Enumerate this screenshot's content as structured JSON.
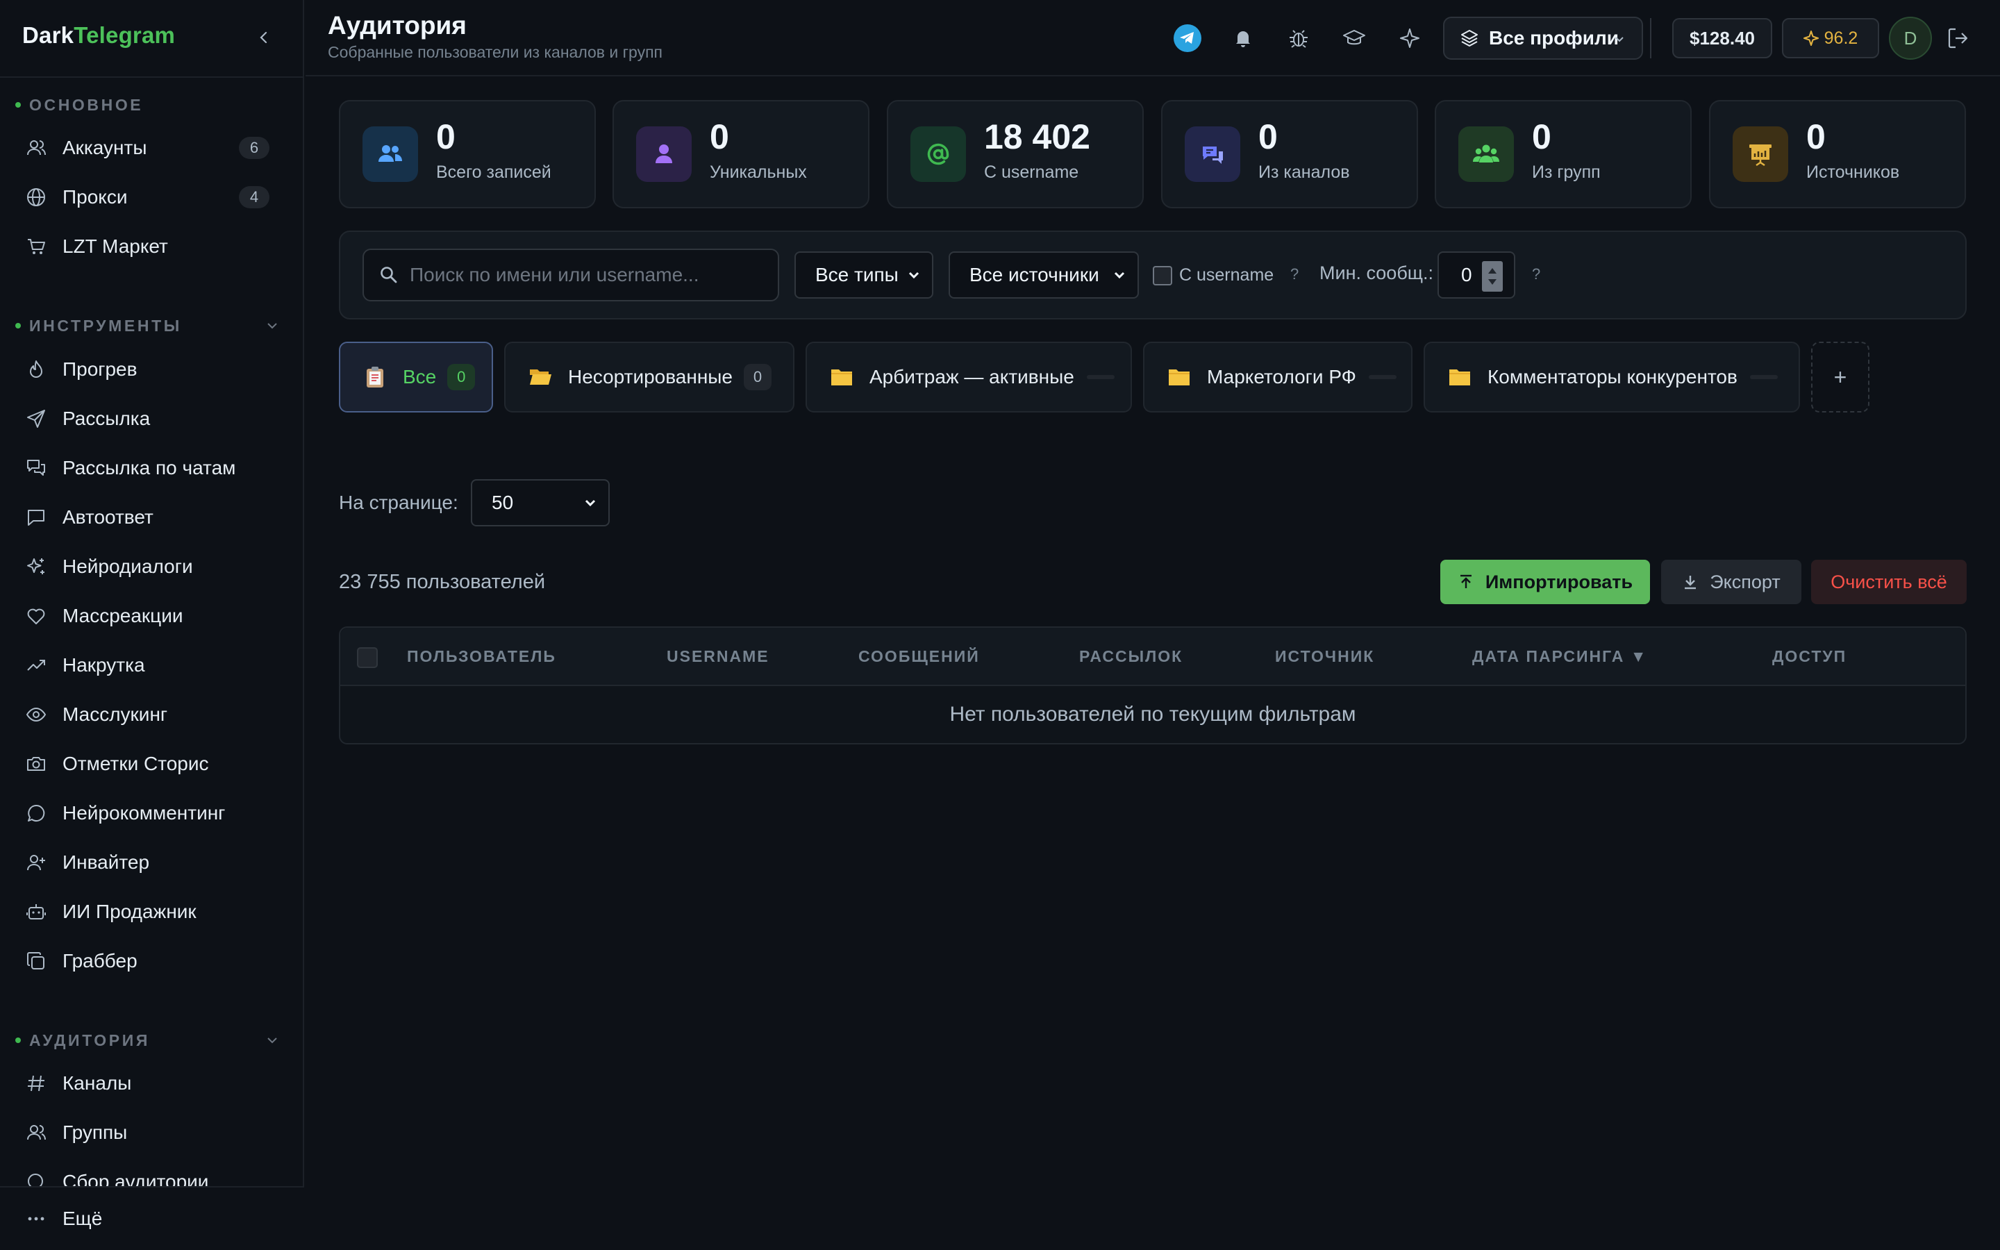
{
  "brand": {
    "part1": "Dark",
    "part2": "Telegram"
  },
  "sidebar": {
    "sections": {
      "main": "ОСНОВНОЕ",
      "tools": "ИНСТРУМЕНТЫ",
      "audience": "АУДИТОРИЯ"
    },
    "main_items": [
      {
        "label": "Аккаунты",
        "badge": "6"
      },
      {
        "label": "Прокси",
        "badge": "4"
      },
      {
        "label": "LZT Маркет"
      }
    ],
    "tool_items": [
      {
        "label": "Прогрев"
      },
      {
        "label": "Рассылка"
      },
      {
        "label": "Рассылка по чатам"
      },
      {
        "label": "Автоответ"
      },
      {
        "label": "Нейродиалоги"
      },
      {
        "label": "Массреакции"
      },
      {
        "label": "Накрутка"
      },
      {
        "label": "Масслукинг"
      },
      {
        "label": "Отметки Сторис"
      },
      {
        "label": "Нейрокомментинг"
      },
      {
        "label": "Инвайтер"
      },
      {
        "label": "ИИ Продажник"
      },
      {
        "label": "Граббер"
      }
    ],
    "audience_items": [
      {
        "label": "Каналы"
      },
      {
        "label": "Группы"
      },
      {
        "label": "Сбор аудитории"
      }
    ],
    "more_label": "Ещё"
  },
  "header": {
    "title": "Аудитория",
    "subtitle": "Собранные пользователи из каналов и групп",
    "profile_select": "Все профили",
    "balance": "$128.40",
    "stars": "96.2",
    "avatar_letter": "D"
  },
  "stats": [
    {
      "value": "0",
      "label": "Всего записей",
      "icon": "users-icon",
      "color": "#58a6ff"
    },
    {
      "value": "0",
      "label": "Уникальных",
      "icon": "user-icon",
      "color": "#a371f7"
    },
    {
      "value": "18 402",
      "label": "С username",
      "icon": "at-icon",
      "color": "#3fb950"
    },
    {
      "value": "0",
      "label": "Из каналов",
      "icon": "broadcast-icon",
      "color": "#6e7bff"
    },
    {
      "value": "0",
      "label": "Из групп",
      "icon": "group-icon",
      "color": "#56d364"
    },
    {
      "value": "0",
      "label": "Источников",
      "icon": "presentation-icon",
      "color": "#e3b341"
    }
  ],
  "filters": {
    "search_placeholder": "Поиск по имени или username...",
    "type_select": "Все типы",
    "source_select": "Все источники",
    "username_checkbox": "С username",
    "help": "?",
    "min_msgs_label": "Мин. сообщ.:",
    "min_msgs_value": "0"
  },
  "folders": [
    {
      "label": "Все",
      "count": "0",
      "icon": "clipboard-icon"
    },
    {
      "label": "Несортированные",
      "count": "0",
      "icon": "folder-open-icon"
    },
    {
      "label": "Арбитраж — активные",
      "icon": "folder-icon"
    },
    {
      "label": "Маркетологи РФ",
      "icon": "folder-icon"
    },
    {
      "label": "Комментаторы конкурентов",
      "icon": "folder-icon"
    }
  ],
  "add_folder": "+",
  "perpage": {
    "label": "На странице:",
    "value": "50"
  },
  "total_label": "23 755 пользователей",
  "actions": {
    "import": "Импортировать",
    "export": "Экспорт",
    "clear": "Очистить всё"
  },
  "table": {
    "columns": [
      "ПОЛЬЗОВАТЕЛЬ",
      "USERNAME",
      "СООБЩЕНИЙ",
      "РАССЫЛОК",
      "ИСТОЧНИК",
      "ДАТА ПАРСИНГА ▼",
      "ДОСТУП"
    ],
    "empty": "Нет пользователей по текущим фильтрам"
  }
}
